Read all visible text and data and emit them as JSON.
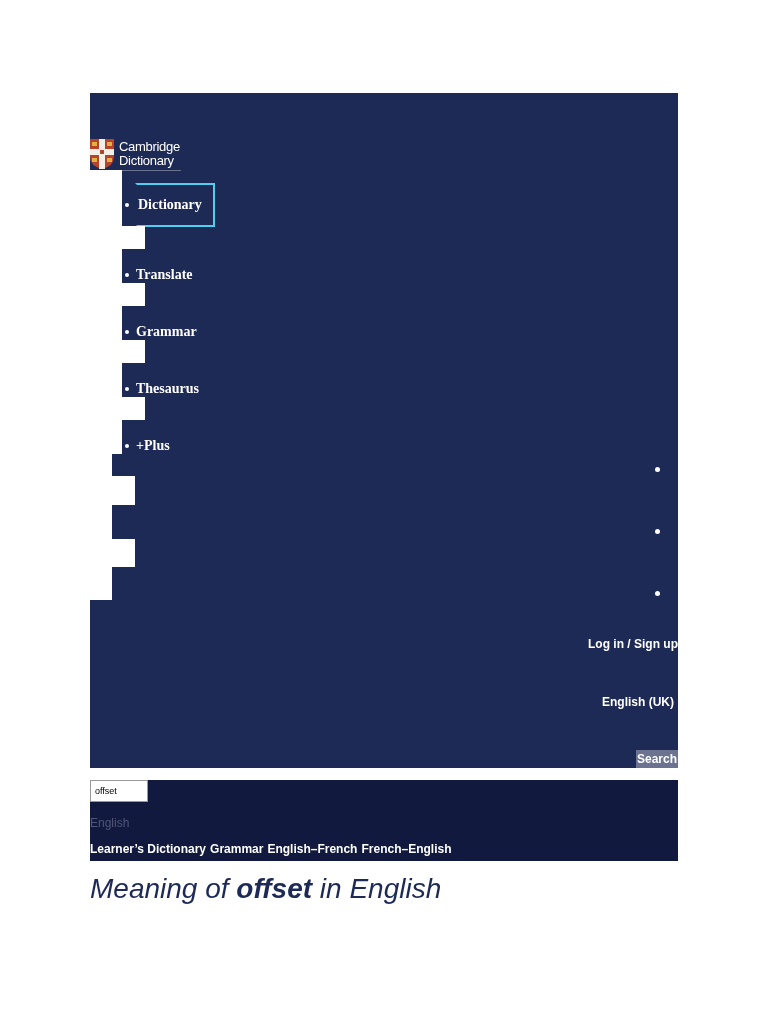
{
  "logo": {
    "text": "Cambridge Dictionary"
  },
  "nav": [
    {
      "label": "Dictionary",
      "selected": true
    },
    {
      "label": "Translate",
      "selected": false
    },
    {
      "label": "Grammar",
      "selected": false
    },
    {
      "label": "Thesaurus",
      "selected": false
    },
    {
      "label": "+Plus",
      "selected": false
    }
  ],
  "account": {
    "login": "Log in / Sign up",
    "language": "English (UK)"
  },
  "search": {
    "button": "Search",
    "value": "offset",
    "dictionary": "English"
  },
  "dictionary_links": [
    "Learner’s Dictionary",
    "Grammar",
    "English–French",
    "French–English"
  ],
  "heading": "Meaning of **offset** in English"
}
